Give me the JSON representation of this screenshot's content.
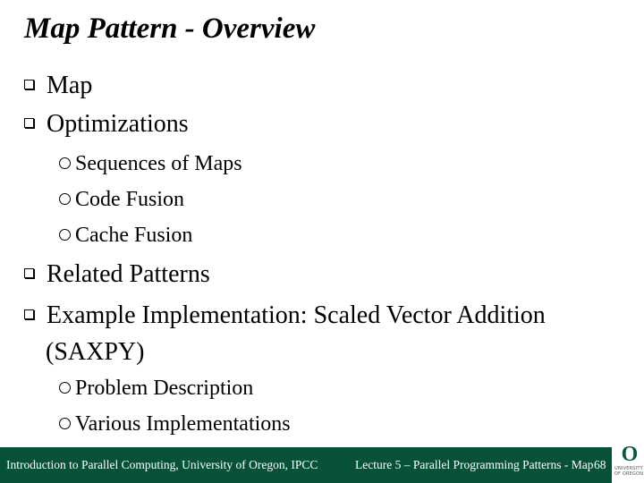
{
  "slide": {
    "title": "Map Pattern - Overview",
    "items": [
      {
        "level": 1,
        "text": "Map"
      },
      {
        "level": 1,
        "text": "Optimizations"
      },
      {
        "level": 2,
        "text": "Sequences of Maps"
      },
      {
        "level": 2,
        "text": "Code Fusion"
      },
      {
        "level": 2,
        "text": "Cache Fusion"
      },
      {
        "level": 1,
        "text": "Related Patterns"
      },
      {
        "level": 1,
        "text": "Example Implementation: Scaled Vector Addition",
        "continuation": "(SAXPY)"
      },
      {
        "level": 2,
        "text": "Problem Description"
      },
      {
        "level": 2,
        "text": "Various Implementations"
      }
    ]
  },
  "footer": {
    "left": "Introduction to Parallel Computing, University of Oregon, IPCC",
    "center": "Lecture 5 – Parallel Programming Patterns - Map",
    "page": "68",
    "color": "#07513a"
  },
  "logo": {
    "glyph": "O",
    "line1": "UNIVERSITY",
    "line2": "OF OREGON",
    "color": "#0b5b3a"
  }
}
